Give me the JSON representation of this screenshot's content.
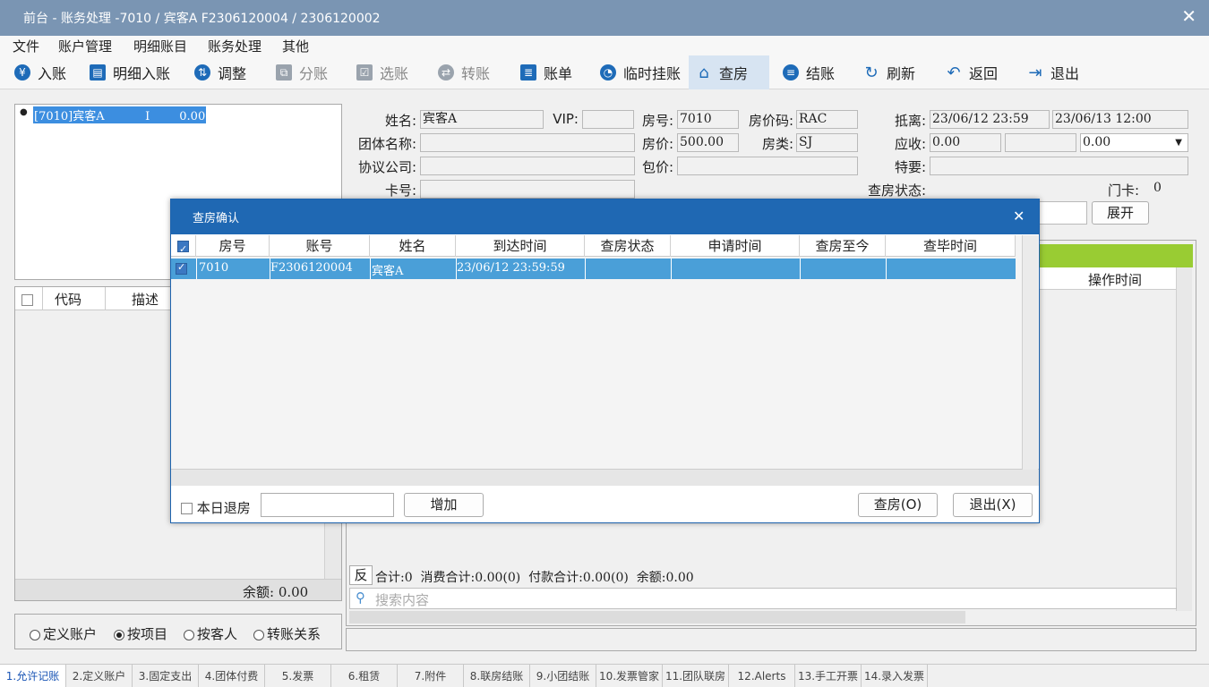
{
  "window": {
    "title": "前台 - 账务处理 -7010  /  宾客A  F2306120004  /  2306120002"
  },
  "menu": [
    "文件",
    "账户管理",
    "明细账目",
    "账务处理",
    "其他"
  ],
  "toolbar": [
    {
      "label": "入账",
      "icon": "yen-icon",
      "glyph": "¥",
      "state": "enabled"
    },
    {
      "label": "明细入账",
      "icon": "card-icon",
      "glyph": "▤",
      "state": "enabled"
    },
    {
      "label": "调整",
      "icon": "adjust-icon",
      "glyph": "⇅",
      "state": "enabled"
    },
    {
      "label": "分账",
      "icon": "split-icon",
      "glyph": "⧉",
      "state": "disabled"
    },
    {
      "label": "选账",
      "icon": "select-icon",
      "glyph": "☑",
      "state": "disabled"
    },
    {
      "label": "转账",
      "icon": "transfer-icon",
      "glyph": "⇄",
      "state": "disabled"
    },
    {
      "label": "账单",
      "icon": "bill-icon",
      "glyph": "≣",
      "state": "enabled"
    },
    {
      "label": "临时挂账",
      "icon": "clock-icon",
      "glyph": "◔",
      "state": "enabled"
    },
    {
      "label": "查房",
      "icon": "house-icon",
      "glyph": "⌂",
      "state": "active"
    },
    {
      "label": "结账",
      "icon": "database-icon",
      "glyph": "≡",
      "state": "enabled"
    },
    {
      "label": "刷新",
      "icon": "refresh-icon",
      "glyph": "↻",
      "state": "enabled"
    },
    {
      "label": "返回",
      "icon": "undo-icon",
      "glyph": "↶",
      "state": "enabled"
    },
    {
      "label": "退出",
      "icon": "exit-icon",
      "glyph": "⇥",
      "state": "enabled"
    }
  ],
  "accounts_tree": {
    "item": "[7010]宾客A           I        0.00"
  },
  "guest": {
    "name_label": "姓名:",
    "name": "宾客A",
    "vip_label": "VIP:",
    "vip": "",
    "room_label": "房号:",
    "room": "7010",
    "rate_code_label": "房价码:",
    "rate_code": "RAC",
    "stay_label": "抵离:",
    "arrival": "23/06/12 23:59",
    "departure": "23/06/13 12:00",
    "group_label": "团体名称:",
    "group": "",
    "price_label": "房价:",
    "price": "500.00",
    "room_type_label": "房类:",
    "room_type": "SJ",
    "receivable_label": "应收:",
    "receivable": "0.00",
    "receivable2": "",
    "receivable3": "0.00",
    "company_label": "协议公司:",
    "company": "",
    "package_label": "包价:",
    "package": "",
    "special_label": "特要:",
    "special": "",
    "card_label": "卡号:",
    "card": "",
    "inspection_status_label": "查房状态:",
    "door_card_label": "门卡:",
    "door_card": "0",
    "expand_button": "展开"
  },
  "left_grid": {
    "code_header": "代码",
    "desc_header": "描述",
    "balance": "余额: 0.00"
  },
  "view_options": [
    {
      "label": "定义账户",
      "selected": false
    },
    {
      "label": "按项目",
      "selected": true
    },
    {
      "label": "按客人",
      "selected": false
    },
    {
      "label": "转账关系",
      "selected": false
    }
  ],
  "right_grid": {
    "op_time_header": "操作时间",
    "reverse_label": "反",
    "summary": "合计:0  消费合计:0.00(0)  付款合计:0.00(0)  余额:0.00",
    "search_placeholder": "搜索内容"
  },
  "dialog": {
    "title": "查房确认",
    "columns": [
      "房号",
      "账号",
      "姓名",
      "到达时间",
      "查房状态",
      "申请时间",
      "查房至今",
      "查毕时间"
    ],
    "rows": [
      {
        "room": "7010",
        "account": "F2306120004",
        "name": "宾客A",
        "arrival": "23/06/12 23:59:59",
        "status": "",
        "apply": "",
        "elapsed": "",
        "done": ""
      }
    ],
    "today_checkout": "本日退房",
    "add_button": "增加",
    "inspect_button": "查房(O)",
    "exit_button": "退出(X)"
  },
  "bottom_tabs": [
    "1.允许记账",
    "2.定义账户",
    "3.固定支出",
    "4.团体付费",
    "5.发票",
    "6.租赁",
    "7.附件",
    "8.联房结账",
    "9.小团结账",
    "10.发票管家",
    "11.团队联房",
    "12.Alerts",
    "13.手工开票",
    "14.录入发票"
  ],
  "colors": {
    "titlebar": "#7a95b3",
    "dialog_title": "#1f68b3",
    "row_selected": "#4a9fd8",
    "accent_green": "#99cc33",
    "tab_selected": "#1a55b5"
  }
}
